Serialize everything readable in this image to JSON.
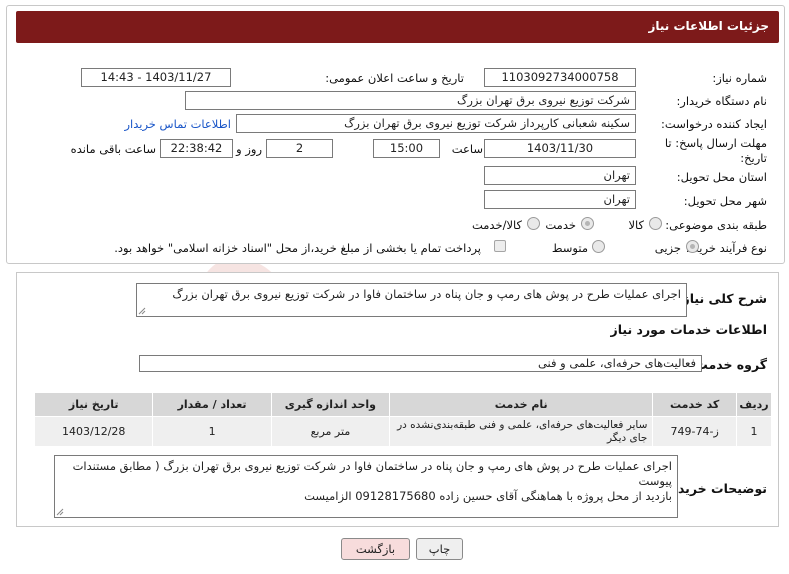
{
  "header": {
    "title": "جزئیات اطلاعات نیاز"
  },
  "fields": {
    "need_number_label": "شماره نیاز:",
    "need_number": "1103092734000758",
    "announce_label": "تاریخ و ساعت اعلان عمومی:",
    "announce_value": "1403/11/27 - 14:43",
    "buyer_org_label": "نام دستگاه خریدار:",
    "buyer_org": "شرکت توزیع نیروی برق تهران بزرگ",
    "requester_label": "ایجاد کننده درخواست:",
    "requester": "سکینه شعبانی کارپرداز شرکت توزیع نیروی برق تهران بزرگ",
    "contact_link": "اطلاعات تماس خریدار",
    "deadline_label_1": "مهلت ارسال پاسخ: تا",
    "deadline_label_2": "تاریخ:",
    "deadline_date": "1403/11/30",
    "time_label": "ساعت",
    "deadline_time": "15:00",
    "days_value": "2",
    "days_label": "روز و",
    "remaining_time": "22:38:42",
    "remaining_label": "ساعت باقی مانده",
    "province_label": "استان محل تحویل:",
    "province": "تهران",
    "city_label": "شهر محل تحویل:",
    "city": "تهران",
    "category_label": "طبقه بندی موضوعی:",
    "category_options": [
      "کالا",
      "خدمت",
      "کالا/خدمت"
    ],
    "category_selected": "خدمت",
    "process_label": "نوع فرآیند خرید :",
    "process_options": [
      "جزیی",
      "متوسط"
    ],
    "process_selected": "جزیی",
    "treasury_note": "پرداخت تمام یا بخشی از مبلغ خرید،از محل \"اسناد خزانه اسلامی\" خواهد بود."
  },
  "summary": {
    "label": "شرح کلی نیاز:",
    "text": "اجرای عملیات طرح در پوش های رمپ و جان پناه در ساختمان فاوا در شرکت توزیع نیروی برق تهران بزرگ"
  },
  "services": {
    "section_title": "اطلاعات خدمات مورد نیاز",
    "group_label": "گروه خدمت:",
    "group_value": "فعالیت‌های حرفه‌ای، علمی و فنی",
    "columns": [
      "ردیف",
      "کد خدمت",
      "نام خدمت",
      "واحد اندازه گیری",
      "تعداد / مقدار",
      "تاریخ نیاز"
    ],
    "rows": [
      [
        "1",
        "ز-74-749",
        "سایر فعالیت‌های حرفه‌ای، علمی و فنی طبقه‌بندی‌نشده در جای دیگر",
        "متر مربع",
        "1",
        "1403/12/28"
      ]
    ]
  },
  "buyer_notes": {
    "label": "توضیحات خریدار:",
    "line1": "اجرای عملیات طرح در پوش های رمپ و جان پناه در ساختمان فاوا در شرکت توزیع نیروی برق تهران بزرگ ( مطابق مستندات پیوست",
    "line2": "بازدید از محل پروژه با هماهنگی آقای حسین زاده 09128175680  الزامیست"
  },
  "buttons": {
    "print": "چاپ",
    "back": "بازگشت"
  },
  "watermark": {
    "text": "AriaTender.neT"
  },
  "colors": {
    "header": "#7d1a1a",
    "link": "#1a56c8",
    "back_button": "#f7dcdc"
  }
}
